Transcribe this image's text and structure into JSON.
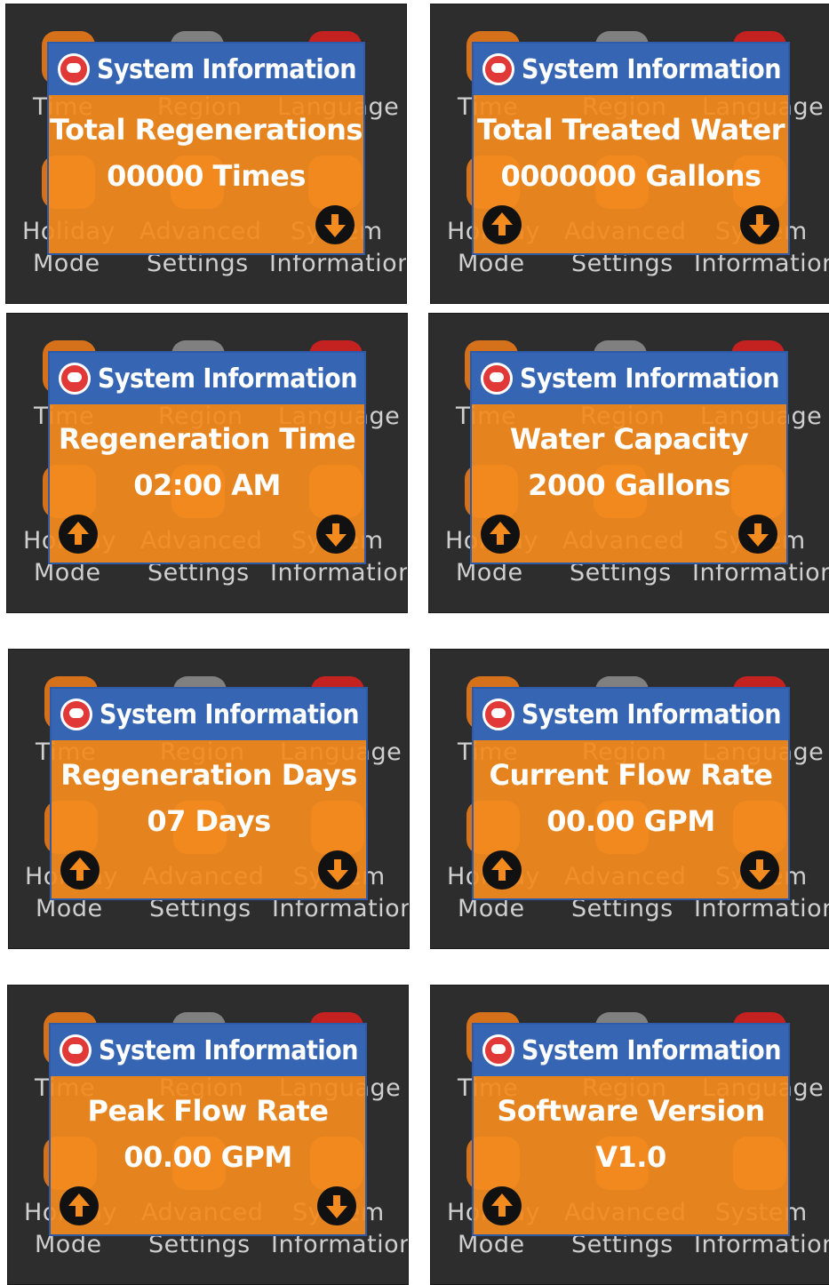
{
  "background_menu": {
    "row1": [
      "Time",
      "Region",
      "Language"
    ],
    "row2_top": [
      "Holiday",
      "Advanced",
      "System"
    ],
    "row2_bottom": [
      "Mode",
      "Settings",
      "Information"
    ]
  },
  "dialog_title": "System Information",
  "screens": [
    {
      "label": "Total Regenerations",
      "value": "00000 Times",
      "has_up": false,
      "has_down": true
    },
    {
      "label": "Total Treated Water",
      "value": "0000000 Gallons",
      "has_up": true,
      "has_down": true
    },
    {
      "label": "Regeneration Time",
      "value": "02:00 AM",
      "has_up": true,
      "has_down": true
    },
    {
      "label": "Water Capacity",
      "value": "2000 Gallons",
      "has_up": true,
      "has_down": true
    },
    {
      "label": "Regeneration Days",
      "value": "07 Days",
      "has_up": true,
      "has_down": true
    },
    {
      "label": "Current Flow Rate",
      "value": "00.00 GPM",
      "has_up": true,
      "has_down": true
    },
    {
      "label": "Peak Flow Rate",
      "value": "00.00 GPM",
      "has_up": true,
      "has_down": true
    },
    {
      "label": "Software Version",
      "value": "V1.0",
      "has_up": true,
      "has_down": false
    }
  ],
  "colors": {
    "dialog": "#f38b1e",
    "titlebar": "#3665b3",
    "screen_bg": "#2d2d2d"
  }
}
